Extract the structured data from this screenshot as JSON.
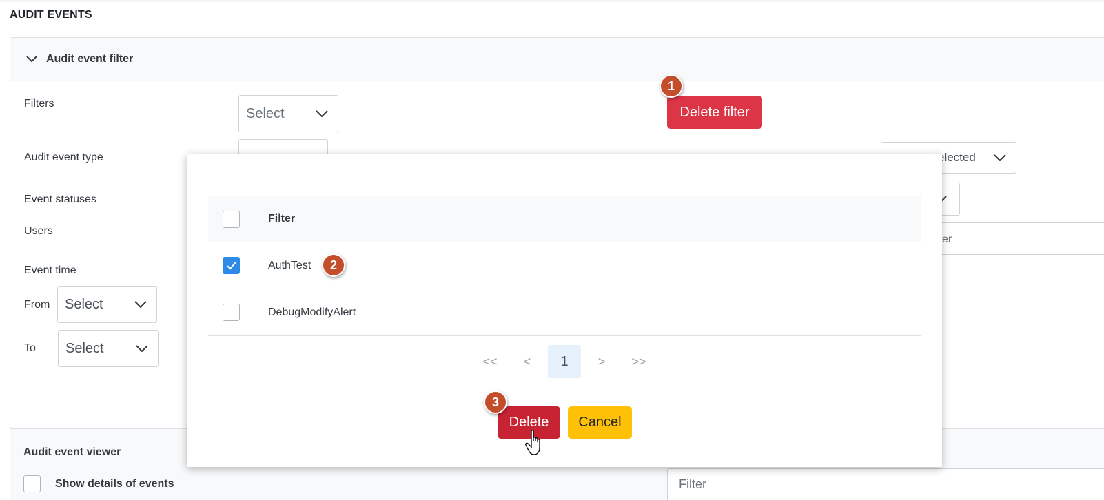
{
  "page": {
    "title": "AUDIT EVENTS"
  },
  "filter_panel": {
    "header": "Audit event filter",
    "filters_label": "Filters",
    "filters_select": "Select",
    "delete_filter_button": "Delete filter",
    "audit_event_type_label": "Audit event type",
    "event_statuses_label": "Event statuses",
    "users_label": "Users",
    "event_time_label": "Event time",
    "from_label": "From",
    "from_select": "Select",
    "to_label": "To",
    "to_select": "Select",
    "right_select_partial": "elected",
    "right_input_partial": "er"
  },
  "viewer": {
    "title": "Audit event viewer",
    "show_details_label": "Show details of events",
    "filter_placeholder": "Filter"
  },
  "modal": {
    "column_header": "Filter",
    "rows": [
      {
        "name": "AuthTest",
        "checked": true
      },
      {
        "name": "DebugModifyAlert",
        "checked": false
      }
    ],
    "pagination": {
      "first": "<<",
      "prev": "<",
      "current": "1",
      "next": ">",
      "last": ">>"
    },
    "delete_button": "Delete",
    "cancel_button": "Cancel"
  },
  "annotations": {
    "step1": "1",
    "step2": "2",
    "step3": "3"
  },
  "colors": {
    "danger": "#dc3545",
    "warning": "#ffc107",
    "primary": "#2d8ae6",
    "badge": "#c44e2b"
  },
  "icons": [
    "chevron-down-icon",
    "check-icon",
    "hand-cursor-icon"
  ]
}
